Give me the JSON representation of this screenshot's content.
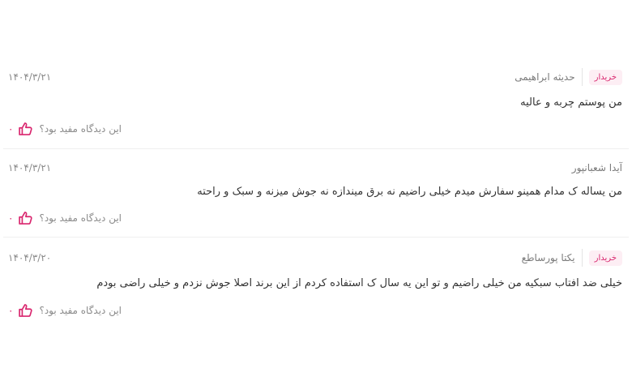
{
  "comments": [
    {
      "author": "حدیثه ابراهیمی",
      "badge": "خریدار",
      "date": "۱۴۰۴/۳/۲۱",
      "text": "من پوستم چربه و عالیه",
      "helpful_question": "این دیدگاه مفید بود؟",
      "likes": "۰"
    },
    {
      "author": "آیدا شعبانپور",
      "badge": "",
      "date": "۱۴۰۴/۳/۲۱",
      "text": "من یساله ک مدام همینو سفارش میدم خیلی راضیم نه برق میندازه نه جوش میزنه و سبک و راحته",
      "helpful_question": "این دیدگاه مفید بود؟",
      "likes": "۰"
    },
    {
      "author": "یکتا پورساطع",
      "badge": "خریدار",
      "date": "۱۴۰۴/۳/۲۰",
      "text": "خیلی ضد افتاب سبکیه من خیلی راضیم و تو این یه سال ک استفاده کردم از این برند اصلا جوش نزدم و خیلی راضی بودم",
      "helpful_question": "این دیدگاه مفید بود؟",
      "likes": "۰"
    }
  ],
  "colors": {
    "accent": "#d9266e",
    "badge_bg": "#fdeef4"
  }
}
